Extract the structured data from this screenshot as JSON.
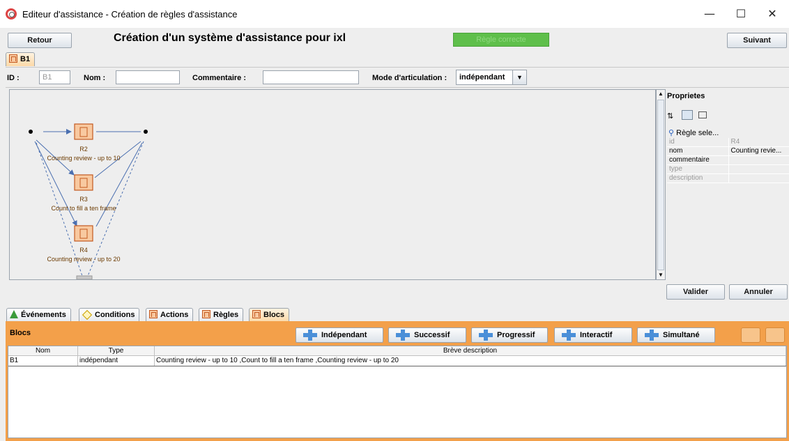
{
  "window": {
    "title": "Editeur d'assistance - Création de règles d'assistance",
    "minimize": "—",
    "maximize": "☐",
    "close": "✕"
  },
  "toolbar": {
    "back_label": "Retour",
    "heading": "Création d'un système d'assistance pour ixl",
    "status_bar": "Règle correcte",
    "next_label": "Suivant"
  },
  "top_tab": {
    "label": "B1"
  },
  "form": {
    "id_label": "ID :",
    "id_value": "B1",
    "name_label": "Nom :",
    "name_value": "",
    "comment_label": "Commentaire :",
    "comment_value": "",
    "mode_label": "Mode d'articulation :",
    "mode_value": "indépendant"
  },
  "graph": {
    "nodes": [
      {
        "id": "R2",
        "label": "Counting review - up to 10"
      },
      {
        "id": "R3",
        "label": "Count to fill a ten frame"
      },
      {
        "id": "R4",
        "label": "Counting review - up to 20"
      }
    ]
  },
  "properties": {
    "title": "Proprietes",
    "selection": "Règle sele...",
    "rows": [
      {
        "key": "id",
        "value": "R4",
        "dim": true
      },
      {
        "key": "nom",
        "value": "Counting revie...",
        "dim": false
      },
      {
        "key": "commentaire",
        "value": "",
        "dim": false
      },
      {
        "key": "type",
        "value": "",
        "dim": true
      },
      {
        "key": "description",
        "value": "",
        "dim": true
      }
    ]
  },
  "actions": {
    "validate_label": "Valider",
    "cancel_label": "Annuler"
  },
  "bottom_tabs": [
    "Événements",
    "Conditions",
    "Actions",
    "Règles",
    "Blocs"
  ],
  "blocs_panel": {
    "title": "Blocs",
    "buttons": [
      "Indépendant",
      "Successif",
      "Progressif",
      "Interactif",
      "Simultané"
    ],
    "columns": [
      "Nom",
      "Type",
      "Brève description"
    ],
    "rows": [
      {
        "nom": "B1",
        "type": "indépendant",
        "description": "Counting review - up to 10 ,Count to fill a ten frame ,Counting review - up to 20"
      }
    ]
  }
}
